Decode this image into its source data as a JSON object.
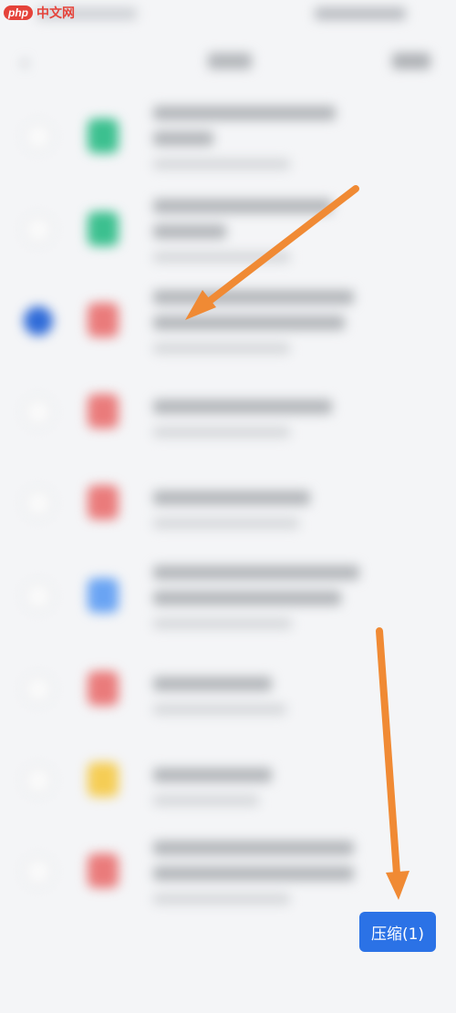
{
  "watermark": {
    "badge": "php",
    "text": "中文网"
  },
  "actions": {
    "compress_label": "压缩(1)"
  },
  "colors": {
    "accent": "#2b72e6",
    "selected_check": "#2f6bd8",
    "arrow": "#f08a34",
    "icon_green": "#3cc08f",
    "icon_red": "#ea7b7b",
    "icon_blue": "#6aa4f3",
    "icon_yellow": "#f5cd55"
  },
  "file_list": {
    "selected_index": 2,
    "items": [
      {
        "icon": "doc-icon",
        "color": "#3cc08f"
      },
      {
        "icon": "doc-icon",
        "color": "#3cc08f"
      },
      {
        "icon": "pdf-icon",
        "color": "#ea7b7b"
      },
      {
        "icon": "pdf-icon",
        "color": "#ea7b7b"
      },
      {
        "icon": "pdf-icon",
        "color": "#ea7b7b"
      },
      {
        "icon": "word-icon",
        "color": "#6aa4f3"
      },
      {
        "icon": "pdf-icon",
        "color": "#ea7b7b"
      },
      {
        "icon": "folder-icon",
        "color": "#f5cd55"
      },
      {
        "icon": "pdf-icon",
        "color": "#ea7b7b"
      }
    ]
  }
}
